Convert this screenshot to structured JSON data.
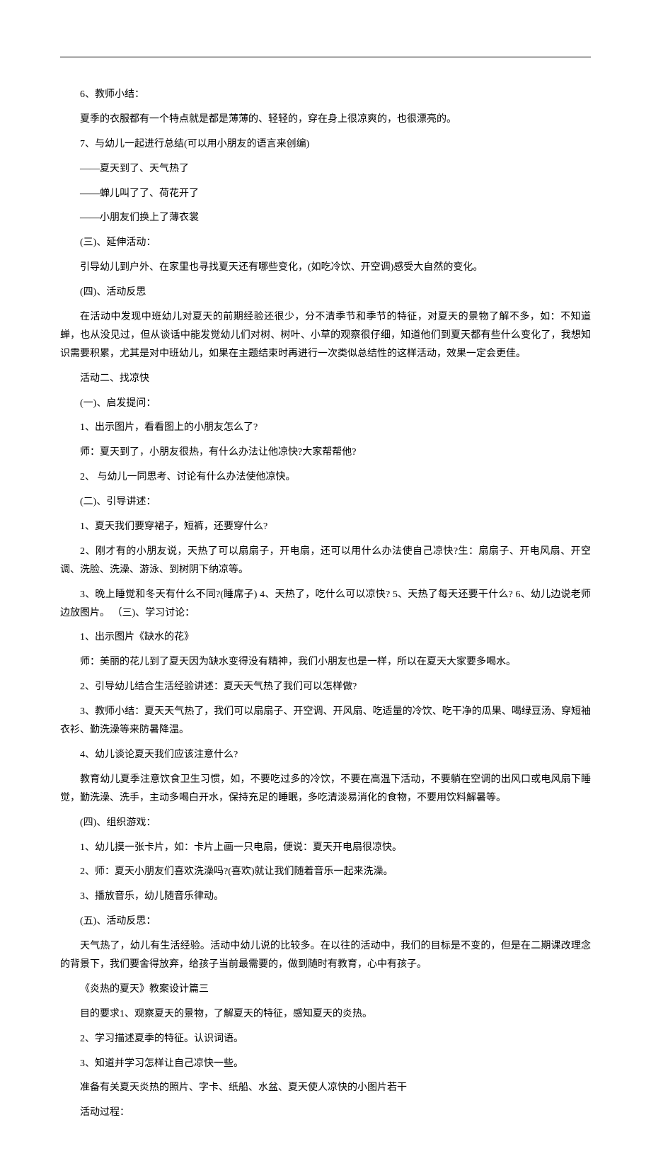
{
  "lines": [
    "6、教师小结：",
    "夏季的衣服都有一个特点就是都是薄薄的、轻轻的，穿在身上很凉爽的，也很漂亮的。",
    "7、与幼儿一起进行总结(可以用小朋友的语言来创编)",
    "——夏天到了、天气热了",
    "——蝉儿叫了了、荷花开了",
    "——小朋友们换上了薄衣裳",
    "(三)、延伸活动：",
    "引导幼儿到户外、在家里也寻找夏天还有哪些变化，(如吃冷饮、开空调)感受大自然的变化。",
    "(四)、活动反思",
    "在活动中发现中班幼儿对夏天的前期经验还很少，分不清季节和季节的特征，对夏天的景物了解不多，如：不知道蝉，也从没见过，但从谈话中能发觉幼儿们对树、树叶、小草的观察很仔细，知道他们到夏天都有些什么变化了，我想知识需要积累，尤其是对中班幼儿，如果在主题结束时再进行一次类似总结性的这样活动，效果一定会更佳。",
    "活动二、找凉快",
    "(一)、启发提问：",
    "1、出示图片，看看图上的小朋友怎么了?",
    "师：夏天到了，小朋友很热，有什么办法让他凉快?大家帮帮他?",
    "2、 与幼儿一同思考、讨论有什么办法使他凉快。",
    "(二)、引导讲述：",
    "1、夏天我们要穿裙子，短裤，还要穿什么?",
    "2、刚才有的小朋友说，天热了可以扇扇子，开电扇，还可以用什么办法使自己凉快?生：扇扇子、开电风扇、开空调、洗脸、洗澡、游泳、到树阴下纳凉等。",
    "3、晚上睡觉和冬天有什么不同?(睡席子) 4、天热了，吃什么可以凉快? 5、天热了每天还要干什么? 6、幼儿边说老师边放图片。 （三)、学习讨论：",
    "1、出示图片《缺水的花》",
    "师：美丽的花儿到了夏天因为缺水变得没有精神，我们小朋友也是一样，所以在夏天大家要多喝水。",
    "2、引导幼儿结合生活经验讲述：夏天天气热了我们可以怎样做?",
    "3、教师小结：夏天天气热了，我们可以扇扇子、开空调、开风扇、吃适量的冷饮、吃干净的瓜果、喝绿豆汤、穿短袖衣衫、勤洗澡等来防暑降温。",
    "4、幼儿谈论夏天我们应该注意什么?",
    "教育幼儿夏季注意饮食卫生习惯，如，不要吃过多的冷饮，不要在高温下活动，不要躺在空调的出风口或电风扇下睡觉，勤洗澡、洗手，主动多喝白开水，保持充足的睡眠，多吃清淡易消化的食物，不要用饮料解暑等。",
    "(四)、组织游戏：",
    "1、幼儿摸一张卡片，如：卡片上画一只电扇，便说：夏天开电扇很凉快。",
    "2、师：夏天小朋友们喜欢洗澡吗?(喜欢)就让我们随着音乐一起来洗澡。",
    "3、播放音乐，幼儿随音乐律动。",
    "(五)、活动反思：",
    "天气热了，幼儿有生活经验。活动中幼儿说的比较多。在以往的活动中，我们的目标是不变的，但是在二期课改理念的背景下，我们要舍得放弃，给孩子当前最需要的，做到随时有教育，心中有孩子。",
    "《炎热的夏天》教案设计篇三",
    "目的要求1、观察夏天的景物，了解夏天的特征，感知夏天的炎热。",
    "2、学习描述夏季的特征。认识词语。",
    "3、知道并学习怎样让自己凉快一些。",
    "准备有关夏天炎热的照片、字卡、纸船、水盆、夏天使人凉快的小图片若干",
    "活动过程："
  ]
}
